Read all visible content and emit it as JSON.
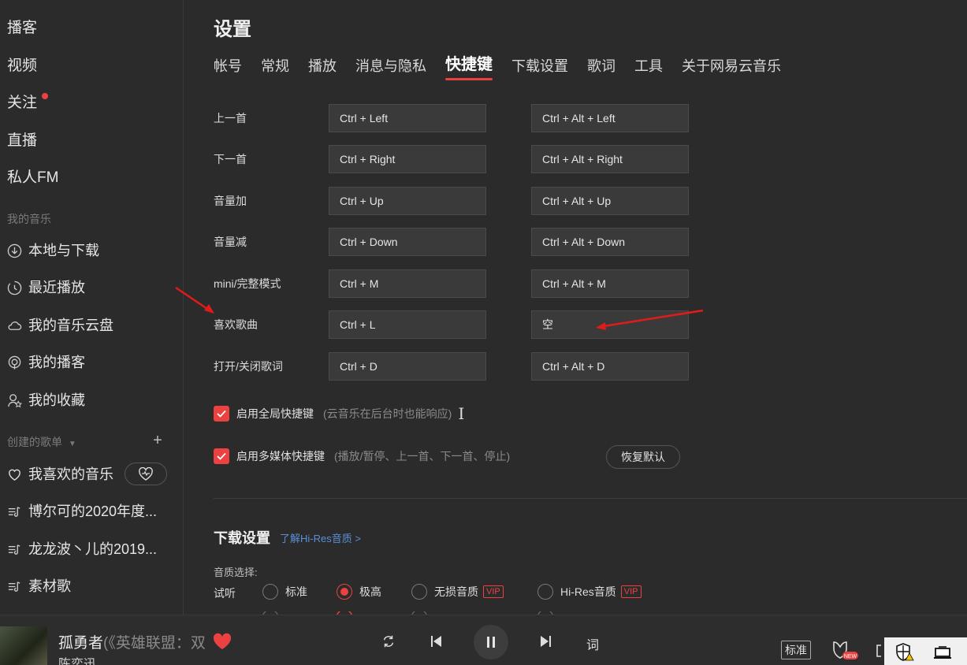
{
  "sidebar": {
    "nav": [
      {
        "label": "播客"
      },
      {
        "label": "视频"
      },
      {
        "label": "关注"
      },
      {
        "label": "直播"
      },
      {
        "label": "私人FM"
      }
    ],
    "my_music_label": "我的音乐",
    "my_music": [
      {
        "label": "本地与下载",
        "icon": "download-icon"
      },
      {
        "label": "最近播放",
        "icon": "recent-icon"
      },
      {
        "label": "我的音乐云盘",
        "icon": "cloud-icon"
      },
      {
        "label": "我的播客",
        "icon": "podcast-icon"
      },
      {
        "label": "我的收藏",
        "icon": "collection-icon"
      }
    ],
    "created_label": "创建的歌单",
    "playlists": [
      {
        "label": "我喜欢的音乐"
      },
      {
        "label": "博尔可的2020年度..."
      },
      {
        "label": "龙龙波丶儿的2019..."
      },
      {
        "label": "素材歌"
      }
    ]
  },
  "main": {
    "title": "设置",
    "tabs": [
      {
        "label": "帐号"
      },
      {
        "label": "常规"
      },
      {
        "label": "播放"
      },
      {
        "label": "消息与隐私"
      },
      {
        "label": "快捷键",
        "active": true
      },
      {
        "label": "下载设置"
      },
      {
        "label": "歌词"
      },
      {
        "label": "工具"
      },
      {
        "label": "关于网易云音乐"
      }
    ],
    "shortcuts": [
      {
        "name": "上一首",
        "local": "Ctrl + Left",
        "global": "Ctrl + Alt + Left"
      },
      {
        "name": "下一首",
        "local": "Ctrl + Right",
        "global": "Ctrl + Alt + Right"
      },
      {
        "name": "音量加",
        "local": "Ctrl + Up",
        "global": "Ctrl + Alt + Up"
      },
      {
        "name": "音量减",
        "local": "Ctrl + Down",
        "global": "Ctrl + Alt + Down"
      },
      {
        "name": "mini/完整模式",
        "local": "Ctrl + M",
        "global": "Ctrl + Alt + M"
      },
      {
        "name": "喜欢歌曲",
        "local": "Ctrl + L",
        "global": "空"
      },
      {
        "name": "打开/关闭歌词",
        "local": "Ctrl + D",
        "global": "Ctrl + Alt + D"
      }
    ],
    "global_hotkey": {
      "label": "启用全局快捷键",
      "hint": "(云音乐在后台时也能响应)",
      "checked": true
    },
    "media_hotkey": {
      "label": "启用多媒体快捷键",
      "hint": "(播放/暂停、上一首、下一首、停止)",
      "checked": true
    },
    "restore_label": "恢复默认",
    "download": {
      "title": "下载设置",
      "link": "了解Hi-Res音质 >",
      "quality_label": "音质选择:",
      "listen_label": "试听",
      "options": [
        {
          "label": "标准",
          "vip": "",
          "selected": false
        },
        {
          "label": "极高",
          "vip": "",
          "selected": true
        },
        {
          "label": "无损音质",
          "vip": "VIP",
          "selected": false
        },
        {
          "label": "Hi-Res音质",
          "vip": "VIP",
          "selected": false
        }
      ]
    }
  },
  "player": {
    "title": "孤勇者",
    "subtitle": "(《英雄联盟：双",
    "artist": "陈奕迅",
    "lyric_label": "词",
    "quality_label": "标准"
  },
  "colors": {
    "accent": "#ec4141",
    "background": "#2b2b2b",
    "link": "#5b8fd6"
  }
}
